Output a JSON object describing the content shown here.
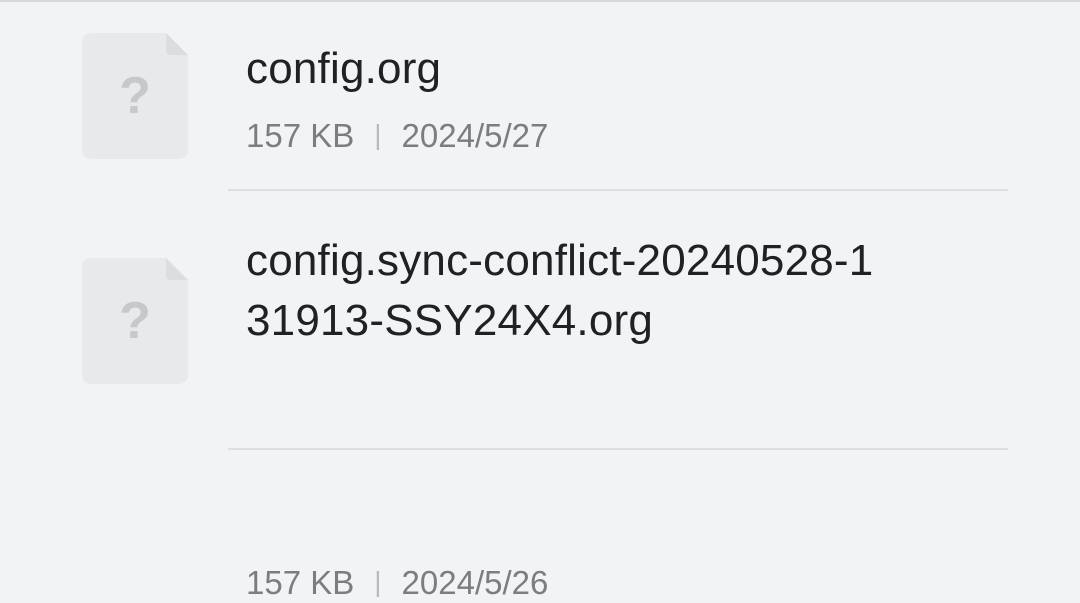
{
  "files": [
    {
      "name": "config.org",
      "size": "157 KB",
      "separator": "|",
      "date": "2024/5/27",
      "icon": "unknown-file-icon"
    },
    {
      "name": "config.sync-conflict-20240528-131913-SSY24X4.org",
      "size": "157 KB",
      "separator": "|",
      "date": "2024/5/26",
      "icon": "unknown-file-icon"
    }
  ],
  "colors": {
    "background": "#f2f3f5",
    "file_name": "#202124",
    "metadata": "#7b7d80",
    "icon_fill": "#e8e9eb",
    "icon_glyph": "#c7c8ca",
    "divider": "#dddee0"
  }
}
